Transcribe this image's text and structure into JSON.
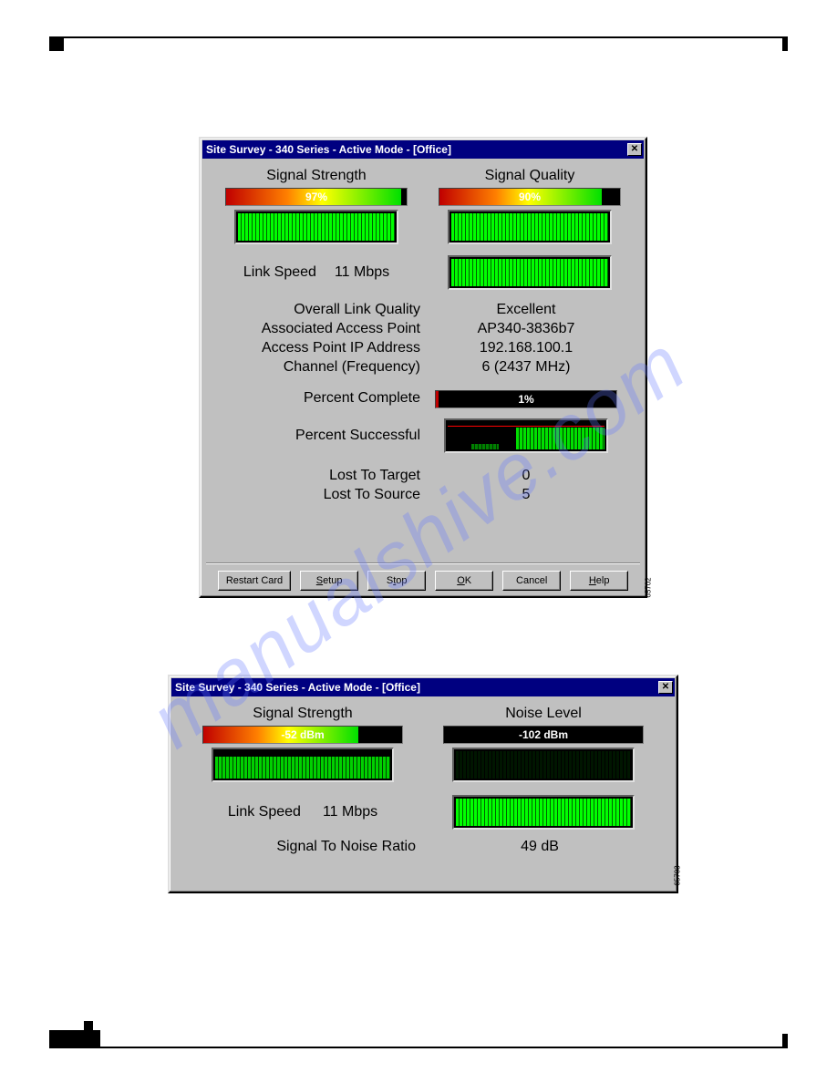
{
  "watermark": "manualshive.com",
  "figids": {
    "fig1": "65702",
    "fig2": "65703"
  },
  "window1": {
    "title": "Site Survey - 340 Series - Active Mode - [Office]",
    "signal_strength_label": "Signal Strength",
    "signal_quality_label": "Signal Quality",
    "signal_strength_value": "97%",
    "signal_quality_value": "90%",
    "link_speed_label": "Link Speed",
    "link_speed_value": "11 Mbps",
    "overall_label": "Overall Link Quality",
    "overall_value": "Excellent",
    "ap_label": "Associated Access Point",
    "ap_value": "AP340-3836b7",
    "ip_label": "Access Point IP Address",
    "ip_value": "192.168.100.1",
    "chan_label": "Channel (Frequency)",
    "chan_value": "6   (2437 MHz)",
    "pct_complete_label": "Percent Complete",
    "pct_complete_value": "1%",
    "pct_success_label": "Percent Successful",
    "lost_target_label": "Lost To Target",
    "lost_target_value": "0",
    "lost_source_label": "Lost To Source",
    "lost_source_value": "5",
    "buttons": {
      "restart": "Restart Card",
      "setup": "Setup",
      "stop": "Stop",
      "ok": "OK",
      "cancel": "Cancel",
      "help": "Help"
    }
  },
  "window2": {
    "title": "Site Survey - 340 Series - Active Mode - [Office]",
    "signal_strength_label": "Signal Strength",
    "noise_label": "Noise Level",
    "signal_strength_value": "-52 dBm",
    "noise_value": "-102 dBm",
    "link_speed_label": "Link Speed",
    "link_speed_value": "11 Mbps",
    "snr_label": "Signal To Noise Ratio",
    "snr_value": "49 dB"
  }
}
